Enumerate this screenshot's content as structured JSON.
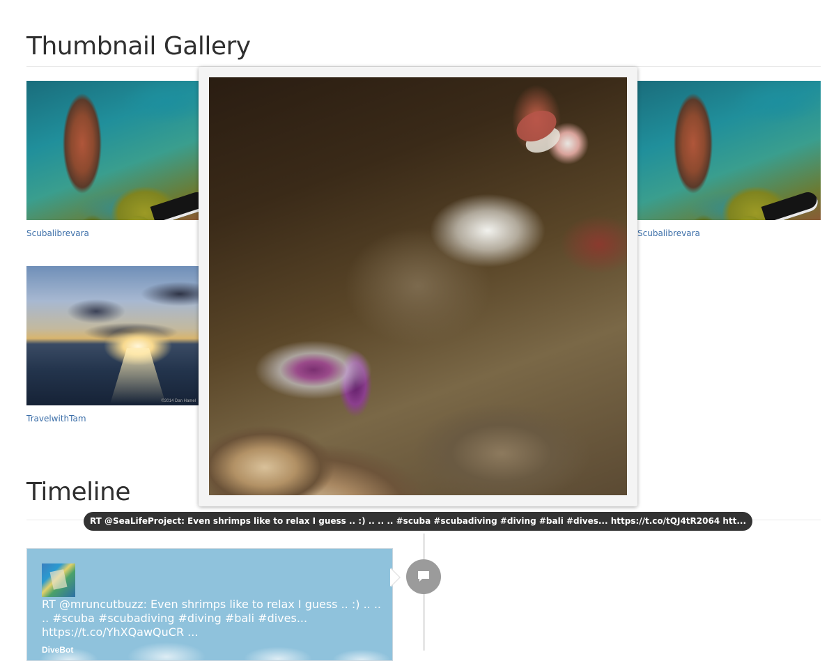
{
  "gallery": {
    "title": "Thumbnail Gallery",
    "items": [
      {
        "caption": "Scubalibrevara",
        "image": "moray-eel-photo"
      },
      {
        "caption": "Scubalibrevara",
        "image": "moray-eel-photo"
      },
      {
        "caption": "TravelwithTam",
        "image": "ocean-sunset-photo"
      }
    ]
  },
  "lightbox": {
    "image": "cleaner-shrimp-photo",
    "caption": "RT @SeaLifeProject: Even shrimps like to relax I guess .. :) .. .. .. #scuba #scubadiving #diving #bali #dives... https://t.co/tQJ4tR2064 htt..."
  },
  "timeline": {
    "title": "Timeline",
    "tweets": [
      {
        "text": "RT @mruncutbuzz: Even shrimps like to relax I guess .. :) .. .. .. #scuba #scubadiving #diving #bali #dives... https://t.co/YhXQawQuCR ...",
        "author": "DiveBot",
        "icon": "speech-bubble-icon"
      }
    ]
  },
  "colors": {
    "link": "#3b6ea8",
    "tweet_card": "#8fc2dc",
    "caption_bar": "#333333",
    "timeline_node": "#9b9b9b"
  }
}
